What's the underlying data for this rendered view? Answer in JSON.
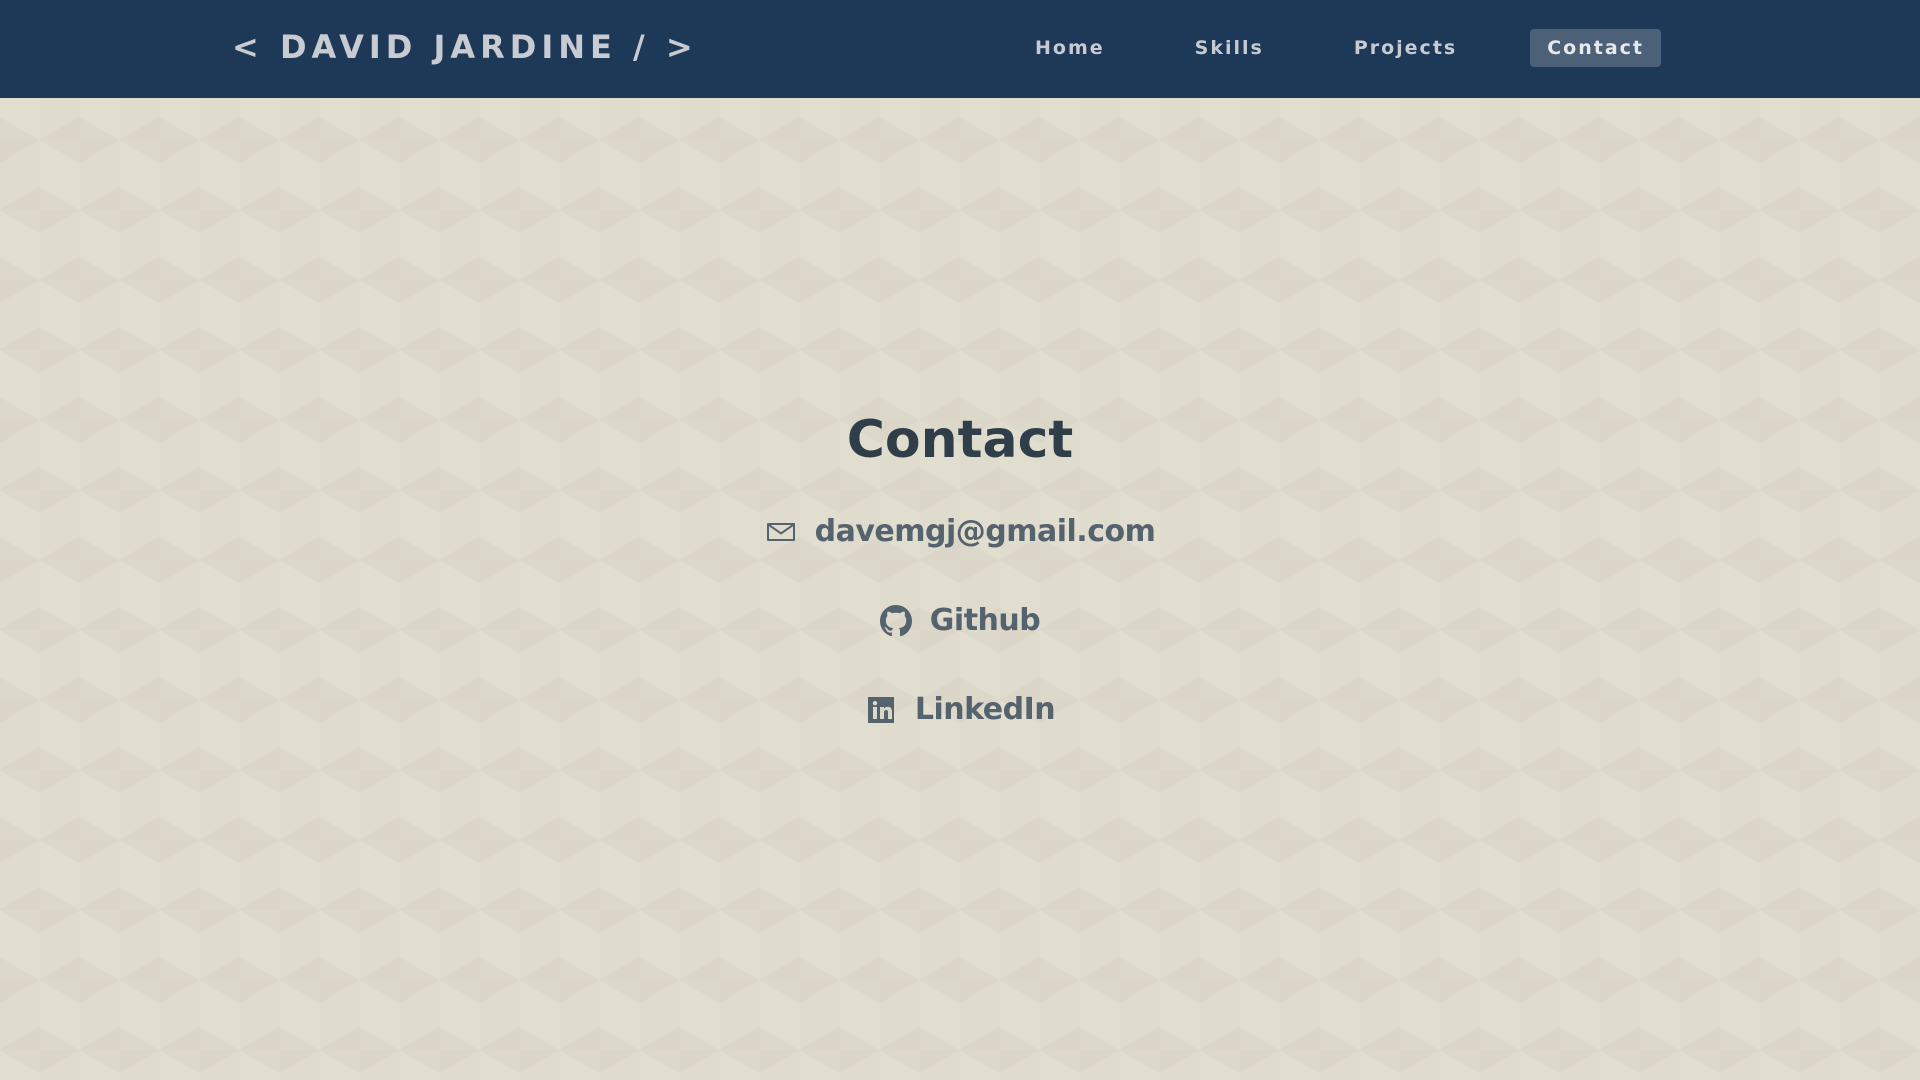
{
  "header": {
    "brand": "< DAVID JARDINE / >",
    "nav": [
      {
        "label": "Home",
        "active": false
      },
      {
        "label": "Skills",
        "active": false
      },
      {
        "label": "Projects",
        "active": false
      },
      {
        "label": "Contact",
        "active": true
      }
    ]
  },
  "contact": {
    "title": "Contact",
    "email": {
      "label": "davemgj@gmail.com",
      "icon": "envelope-icon"
    },
    "github": {
      "label": "Github",
      "icon": "github-icon"
    },
    "linkedin": {
      "label": "LinkedIn",
      "icon": "linkedin-icon"
    }
  },
  "colors": {
    "navbar": "#1e3858",
    "active_tab": "#4c6078",
    "background": "#dfdbcd",
    "heading": "#2f3e48",
    "link": "#54636e"
  }
}
